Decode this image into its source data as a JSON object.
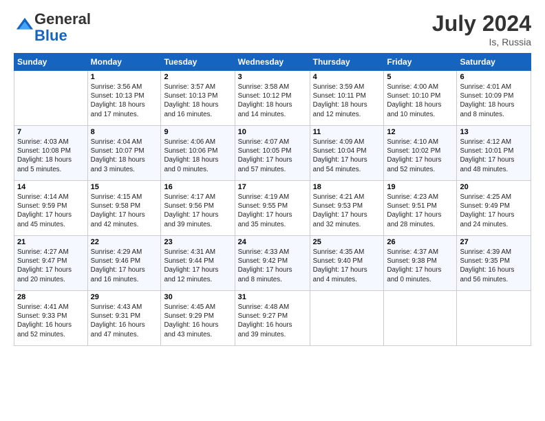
{
  "header": {
    "logo_general": "General",
    "logo_blue": "Blue",
    "month_year": "July 2024",
    "location": "Is, Russia"
  },
  "days_of_week": [
    "Sunday",
    "Monday",
    "Tuesday",
    "Wednesday",
    "Thursday",
    "Friday",
    "Saturday"
  ],
  "weeks": [
    [
      {
        "day": "",
        "info": ""
      },
      {
        "day": "1",
        "info": "Sunrise: 3:56 AM\nSunset: 10:13 PM\nDaylight: 18 hours\nand 17 minutes."
      },
      {
        "day": "2",
        "info": "Sunrise: 3:57 AM\nSunset: 10:13 PM\nDaylight: 18 hours\nand 16 minutes."
      },
      {
        "day": "3",
        "info": "Sunrise: 3:58 AM\nSunset: 10:12 PM\nDaylight: 18 hours\nand 14 minutes."
      },
      {
        "day": "4",
        "info": "Sunrise: 3:59 AM\nSunset: 10:11 PM\nDaylight: 18 hours\nand 12 minutes."
      },
      {
        "day": "5",
        "info": "Sunrise: 4:00 AM\nSunset: 10:10 PM\nDaylight: 18 hours\nand 10 minutes."
      },
      {
        "day": "6",
        "info": "Sunrise: 4:01 AM\nSunset: 10:09 PM\nDaylight: 18 hours\nand 8 minutes."
      }
    ],
    [
      {
        "day": "7",
        "info": "Sunrise: 4:03 AM\nSunset: 10:08 PM\nDaylight: 18 hours\nand 5 minutes."
      },
      {
        "day": "8",
        "info": "Sunrise: 4:04 AM\nSunset: 10:07 PM\nDaylight: 18 hours\nand 3 minutes."
      },
      {
        "day": "9",
        "info": "Sunrise: 4:06 AM\nSunset: 10:06 PM\nDaylight: 18 hours\nand 0 minutes."
      },
      {
        "day": "10",
        "info": "Sunrise: 4:07 AM\nSunset: 10:05 PM\nDaylight: 17 hours\nand 57 minutes."
      },
      {
        "day": "11",
        "info": "Sunrise: 4:09 AM\nSunset: 10:04 PM\nDaylight: 17 hours\nand 54 minutes."
      },
      {
        "day": "12",
        "info": "Sunrise: 4:10 AM\nSunset: 10:02 PM\nDaylight: 17 hours\nand 52 minutes."
      },
      {
        "day": "13",
        "info": "Sunrise: 4:12 AM\nSunset: 10:01 PM\nDaylight: 17 hours\nand 48 minutes."
      }
    ],
    [
      {
        "day": "14",
        "info": "Sunrise: 4:14 AM\nSunset: 9:59 PM\nDaylight: 17 hours\nand 45 minutes."
      },
      {
        "day": "15",
        "info": "Sunrise: 4:15 AM\nSunset: 9:58 PM\nDaylight: 17 hours\nand 42 minutes."
      },
      {
        "day": "16",
        "info": "Sunrise: 4:17 AM\nSunset: 9:56 PM\nDaylight: 17 hours\nand 39 minutes."
      },
      {
        "day": "17",
        "info": "Sunrise: 4:19 AM\nSunset: 9:55 PM\nDaylight: 17 hours\nand 35 minutes."
      },
      {
        "day": "18",
        "info": "Sunrise: 4:21 AM\nSunset: 9:53 PM\nDaylight: 17 hours\nand 32 minutes."
      },
      {
        "day": "19",
        "info": "Sunrise: 4:23 AM\nSunset: 9:51 PM\nDaylight: 17 hours\nand 28 minutes."
      },
      {
        "day": "20",
        "info": "Sunrise: 4:25 AM\nSunset: 9:49 PM\nDaylight: 17 hours\nand 24 minutes."
      }
    ],
    [
      {
        "day": "21",
        "info": "Sunrise: 4:27 AM\nSunset: 9:47 PM\nDaylight: 17 hours\nand 20 minutes."
      },
      {
        "day": "22",
        "info": "Sunrise: 4:29 AM\nSunset: 9:46 PM\nDaylight: 17 hours\nand 16 minutes."
      },
      {
        "day": "23",
        "info": "Sunrise: 4:31 AM\nSunset: 9:44 PM\nDaylight: 17 hours\nand 12 minutes."
      },
      {
        "day": "24",
        "info": "Sunrise: 4:33 AM\nSunset: 9:42 PM\nDaylight: 17 hours\nand 8 minutes."
      },
      {
        "day": "25",
        "info": "Sunrise: 4:35 AM\nSunset: 9:40 PM\nDaylight: 17 hours\nand 4 minutes."
      },
      {
        "day": "26",
        "info": "Sunrise: 4:37 AM\nSunset: 9:38 PM\nDaylight: 17 hours\nand 0 minutes."
      },
      {
        "day": "27",
        "info": "Sunrise: 4:39 AM\nSunset: 9:35 PM\nDaylight: 16 hours\nand 56 minutes."
      }
    ],
    [
      {
        "day": "28",
        "info": "Sunrise: 4:41 AM\nSunset: 9:33 PM\nDaylight: 16 hours\nand 52 minutes."
      },
      {
        "day": "29",
        "info": "Sunrise: 4:43 AM\nSunset: 9:31 PM\nDaylight: 16 hours\nand 47 minutes."
      },
      {
        "day": "30",
        "info": "Sunrise: 4:45 AM\nSunset: 9:29 PM\nDaylight: 16 hours\nand 43 minutes."
      },
      {
        "day": "31",
        "info": "Sunrise: 4:48 AM\nSunset: 9:27 PM\nDaylight: 16 hours\nand 39 minutes."
      },
      {
        "day": "",
        "info": ""
      },
      {
        "day": "",
        "info": ""
      },
      {
        "day": "",
        "info": ""
      }
    ]
  ]
}
